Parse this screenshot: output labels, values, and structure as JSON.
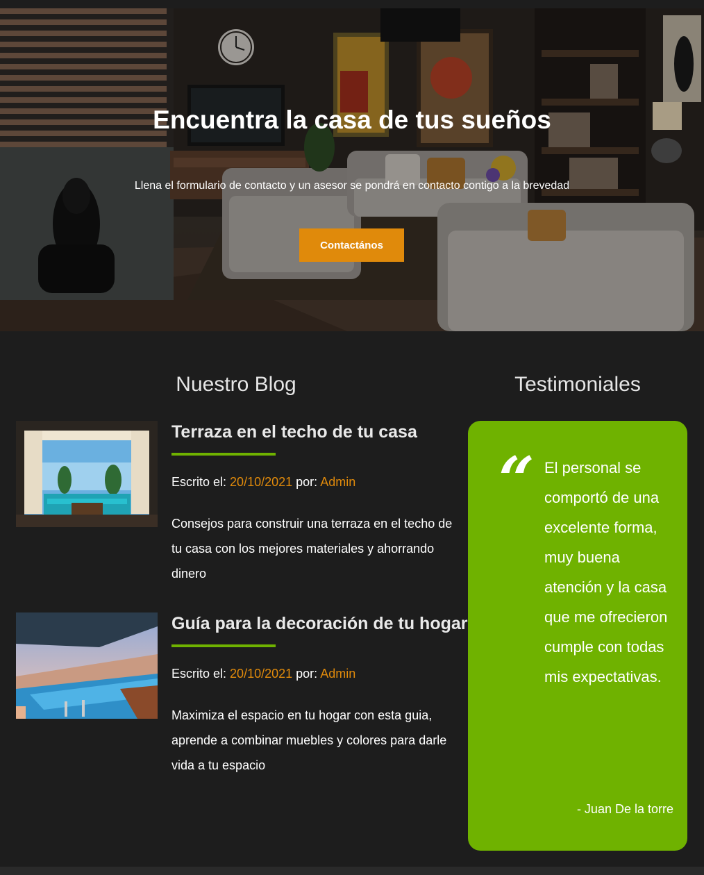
{
  "hero": {
    "title": "Encuentra la casa de tus sueños",
    "subtitle": "Llena el formulario de contacto y un asesor se pondrá en contacto contigo a la brevedad",
    "button_label": "Contactános"
  },
  "blog": {
    "section_title": "Nuestro Blog",
    "posts": [
      {
        "title": "Terraza en el techo de tu casa",
        "written_label": "Escrito el:",
        "date": "20/10/2021",
        "by_label": "por:",
        "author": "Admin",
        "excerpt": "Consejos para construir una terraza en el techo de tu casa con los mejores materiales y ahorrando dinero"
      },
      {
        "title": "Guía para la decoración de tu hogar",
        "written_label": "Escrito el:",
        "date": "20/10/2021",
        "by_label": "por:",
        "author": "Admin",
        "excerpt": "Maximiza el espacio en tu hogar con esta guia, aprende a combinar muebles y colores para darle vida a tu espacio"
      }
    ]
  },
  "testimonials": {
    "section_title": "Testimoniales",
    "quote_mark": "“",
    "quote": "El personal se comportó de una excelente forma, muy buena atención y la casa que me ofrecieron cumple con todas mis expectativas.",
    "author": "- Juan De la torre"
  },
  "colors": {
    "background": "#1d1d1d",
    "accent_orange": "#e08a0b",
    "accent_green": "#6fb200"
  }
}
